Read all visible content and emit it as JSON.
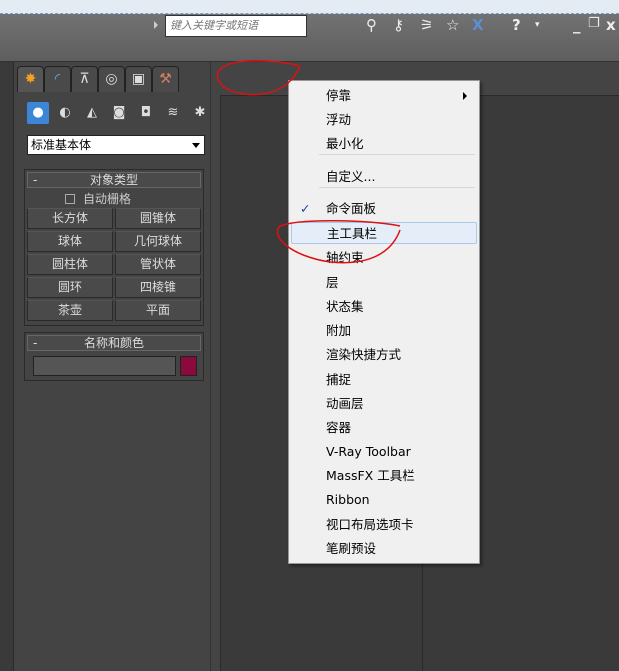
{
  "titlebar": {
    "search_placeholder": "键入关键字或短语",
    "icons": [
      "binoculars-icon",
      "key-icon",
      "satellite-icon",
      "star-icon",
      "x-exchange-icon",
      "help-icon",
      "minimize-icon",
      "restore-icon",
      "close-icon"
    ]
  },
  "panel": {
    "tabs": [
      "create-icon",
      "modify-icon",
      "hierarchy-icon",
      "motion-icon",
      "display-icon",
      "utilities-icon"
    ],
    "subcategories": [
      "geometry-icon",
      "shapes-icon",
      "lights-icon",
      "cameras-icon",
      "helpers-icon",
      "spacewarps-icon",
      "systems-icon"
    ],
    "dropdown_value": "标准基本体",
    "object_type": {
      "title": "对象类型",
      "minus": "-",
      "autogrid": "自动栅格",
      "buttons": [
        "长方体",
        "圆锥体",
        "球体",
        "几何球体",
        "圆柱体",
        "管状体",
        "圆环",
        "四棱锥",
        "茶壶",
        "平面"
      ]
    },
    "name_color": {
      "title": "名称和颜色",
      "minus": "-",
      "color": "#8b0a3d"
    }
  },
  "menu": {
    "items": [
      {
        "label": "停靠",
        "submenu": true
      },
      {
        "label": "浮动"
      },
      {
        "label": "最小化"
      },
      {
        "label": "自定义..."
      },
      {
        "label": "命令面板",
        "checked": true
      },
      {
        "label": "主工具栏",
        "highlighted": true
      },
      {
        "label": "轴约束"
      },
      {
        "label": "层"
      },
      {
        "label": "状态集"
      },
      {
        "label": "附加"
      },
      {
        "label": "渲染快捷方式"
      },
      {
        "label": "捕捉"
      },
      {
        "label": "动画层"
      },
      {
        "label": "容器"
      },
      {
        "label": "V-Ray Toolbar"
      },
      {
        "label": "MassFX 工具栏"
      },
      {
        "label": "Ribbon"
      },
      {
        "label": "视口布局选项卡"
      },
      {
        "label": "笔刷预设"
      }
    ],
    "check_glyph": "✓"
  },
  "annotation_color": "#e01010"
}
